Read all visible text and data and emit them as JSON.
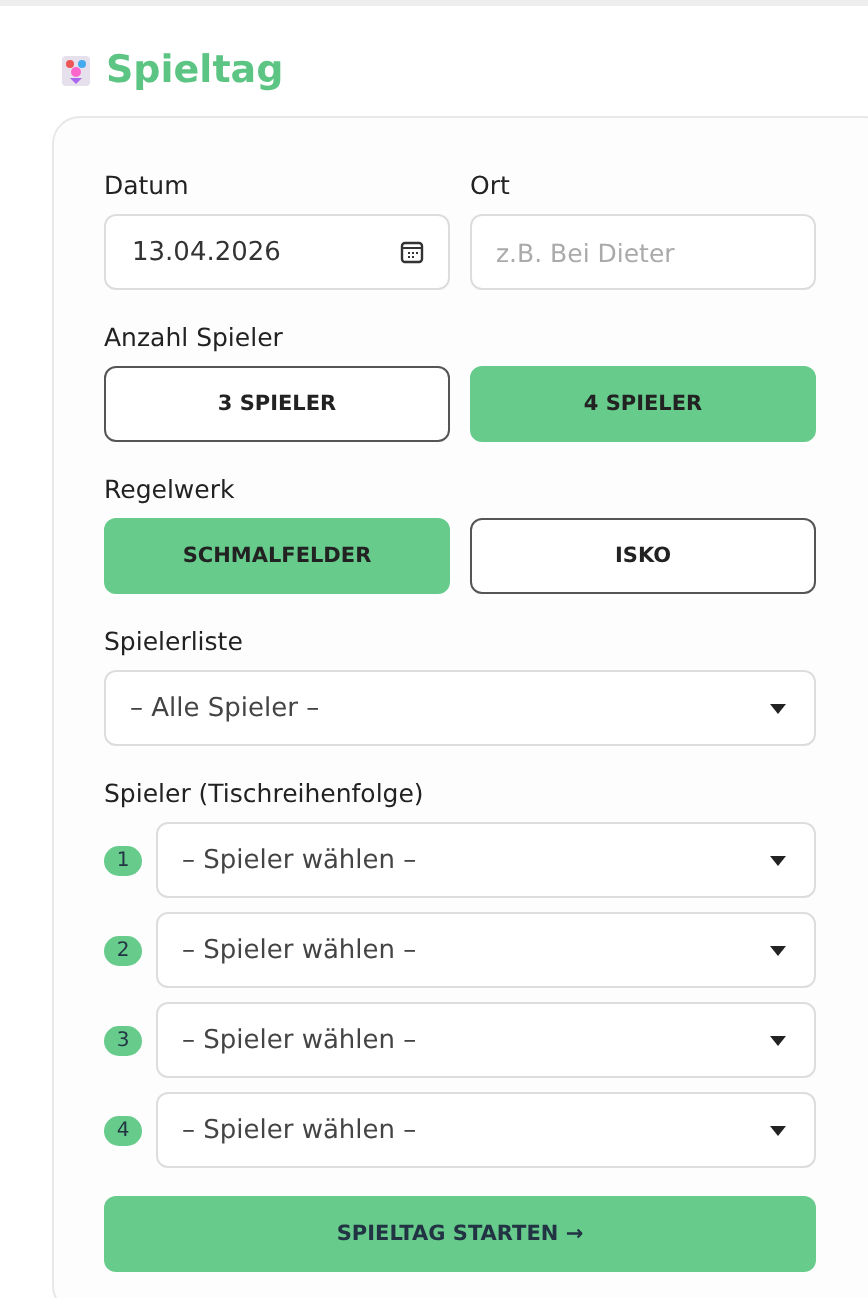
{
  "title": "Spieltag",
  "date": {
    "label": "Datum",
    "value": "13.04.2026"
  },
  "place": {
    "label": "Ort",
    "placeholder": "z.B. Bei Dieter"
  },
  "player_count": {
    "label": "Anzahl Spieler",
    "options": [
      {
        "label": "3 SPIELER",
        "selected": false
      },
      {
        "label": "4 SPIELER",
        "selected": true
      }
    ]
  },
  "ruleset": {
    "label": "Regelwerk",
    "options": [
      {
        "label": "SCHMALFELDER",
        "selected": true
      },
      {
        "label": "ISKO",
        "selected": false
      }
    ]
  },
  "player_list": {
    "label": "Spielerliste",
    "value": "– Alle Spieler –"
  },
  "players": {
    "label": "Spieler (Tischreihenfolge)",
    "slots": [
      {
        "number": "1",
        "value": "– Spieler wählen –"
      },
      {
        "number": "2",
        "value": "– Spieler wählen –"
      },
      {
        "number": "3",
        "value": "– Spieler wählen –"
      },
      {
        "number": "4",
        "value": "– Spieler wählen –"
      }
    ]
  },
  "start_button": "SPIELTAG STARTEN →"
}
